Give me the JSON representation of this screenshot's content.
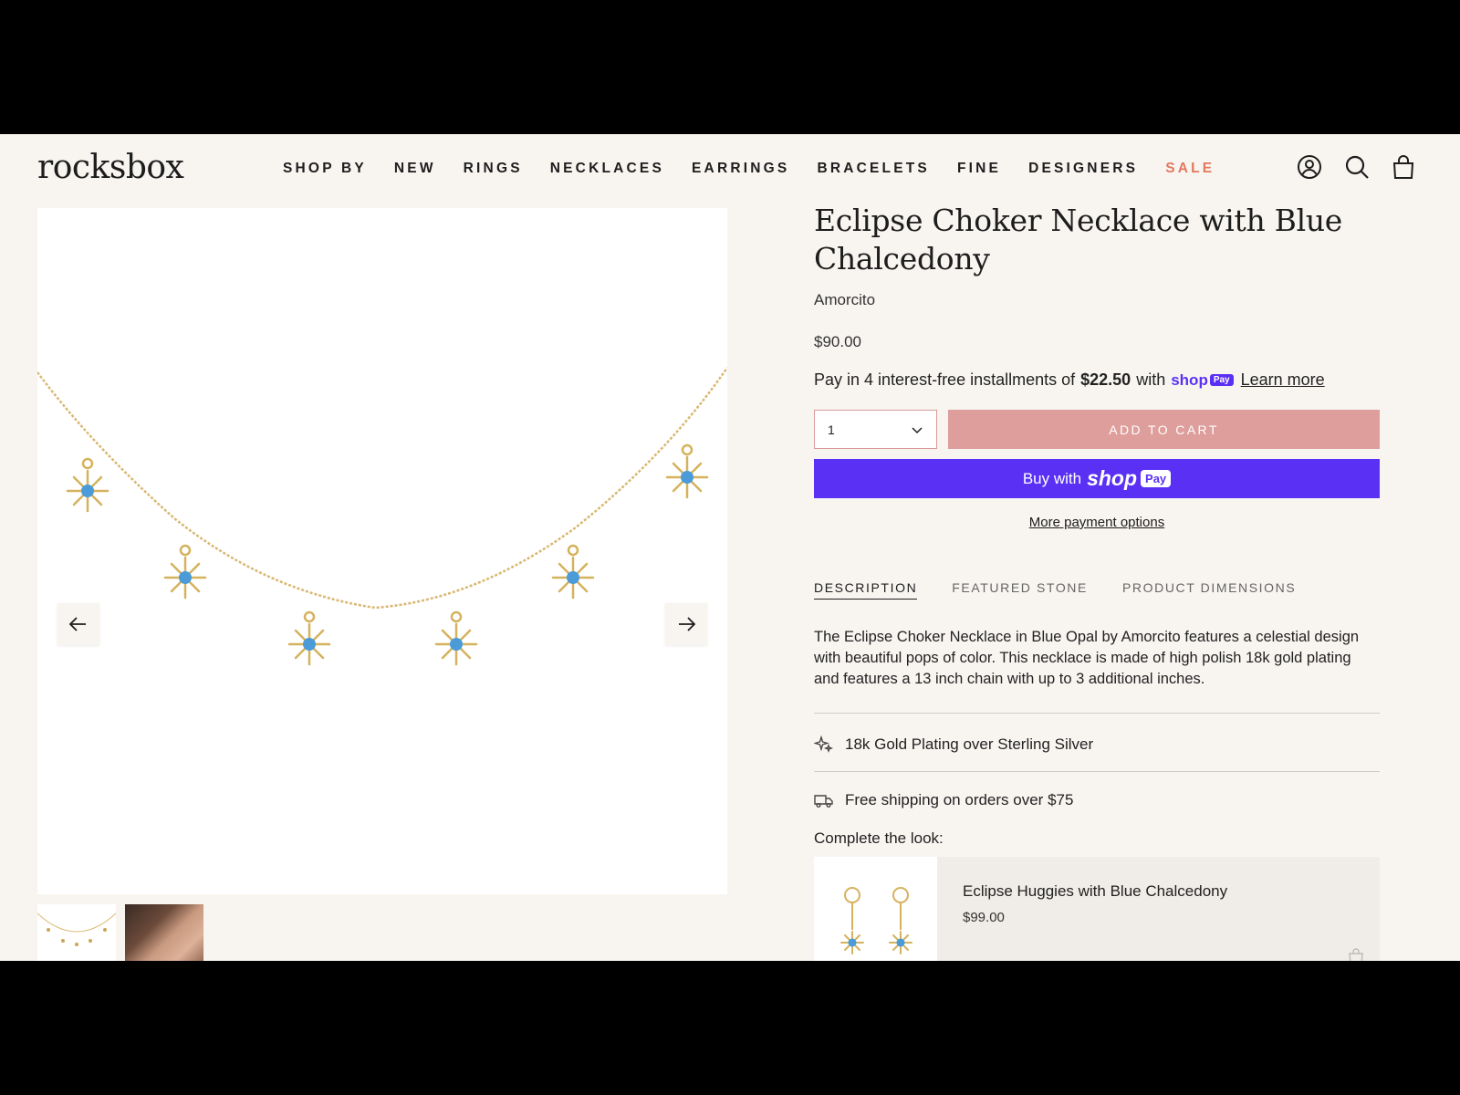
{
  "header": {
    "logo": "rocksbox",
    "nav": [
      "SHOP BY",
      "NEW",
      "RINGS",
      "NECKLACES",
      "EARRINGS",
      "BRACELETS",
      "FINE",
      "DESIGNERS",
      "SALE"
    ],
    "icons": [
      "account-icon",
      "search-icon",
      "cart-icon"
    ],
    "sale_color": "#e2785e"
  },
  "gallery": {
    "prev_icon": "arrow-left-icon",
    "next_icon": "arrow-right-icon"
  },
  "product": {
    "title": "Eclipse Choker Necklace with Blue Chalcedony",
    "brand": "Amorcito",
    "price": "$90.00",
    "installments": {
      "prefix": "Pay in 4 interest-free installments of",
      "amount": "$22.50",
      "with": "with",
      "shop": "shop",
      "pay": "Pay",
      "learn_more": "Learn more"
    },
    "quantity": "1",
    "add_to_cart": "ADD TO CART",
    "buy_with": "Buy with",
    "buy_shop": "shop",
    "buy_pay": "Pay",
    "more_payment": "More payment options",
    "accent_color": "#5a31f4",
    "cart_color": "#dd9e9c"
  },
  "tabs": [
    "DESCRIPTION",
    "FEATURED STONE",
    "PRODUCT DIMENSIONS"
  ],
  "description": "The Eclipse Choker Necklace in Blue Opal by Amorcito features a celestial design with beautiful pops of color. This necklace is made of high polish 18k gold plating and features a 13 inch chain with up to 3 additional inches.",
  "features": [
    {
      "icon": "sparkle-icon",
      "text": "18k Gold Plating over Sterling Silver"
    },
    {
      "icon": "truck-icon",
      "text": "Free shipping on orders over $75"
    }
  ],
  "complete_look": {
    "label": "Complete the look:",
    "name": "Eclipse Huggies with Blue Chalcedony",
    "price": "$99.00"
  }
}
